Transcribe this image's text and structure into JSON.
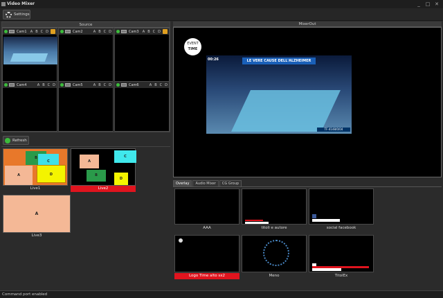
{
  "window": {
    "title": "Video Mixer",
    "minimize": "_",
    "maximize": "□",
    "close": "✕"
  },
  "toolbar": {
    "settings_label": "Settings"
  },
  "source": {
    "title": "Source",
    "cameras": [
      {
        "name": "Cam1",
        "letters": [
          "A",
          "B",
          "C",
          "D"
        ],
        "has_warning": true
      },
      {
        "name": "Cam2",
        "letters": [
          "A",
          "B",
          "C",
          "D"
        ],
        "has_warning": false
      },
      {
        "name": "Cam3",
        "letters": [
          "A",
          "B",
          "C",
          "D"
        ],
        "has_warning": true
      },
      {
        "name": "Cam4",
        "letters": [
          "A",
          "B",
          "C",
          "D"
        ],
        "has_warning": false
      },
      {
        "name": "Cam5",
        "letters": [
          "A",
          "B",
          "C",
          "D"
        ],
        "has_warning": false
      },
      {
        "name": "Cam6",
        "letters": [
          "A",
          "B",
          "C",
          "D"
        ],
        "has_warning": false
      }
    ]
  },
  "refresh": {
    "label": "Refresh"
  },
  "scenes": [
    {
      "label": "Live1",
      "boxes": [
        "A",
        "B",
        "C",
        "D"
      ]
    },
    {
      "label": "Live2",
      "boxes": [
        "A",
        "B",
        "C",
        "D"
      ],
      "active": true
    },
    {
      "label": "Live3",
      "boxes": [
        "A"
      ]
    }
  ],
  "mixer": {
    "title": "MixerOut",
    "logo_line1": "EVENT",
    "logo_line2": "TIME",
    "clock": "00:26",
    "headline": "LE VERE CAUSE DELL'ALZHEIMER",
    "ticker": "TF-4148/0/04"
  },
  "tabs": [
    "Overlay",
    "Audio Mixer",
    "CG Group"
  ],
  "overlays": [
    {
      "label": "AAA"
    },
    {
      "label": "titoli e autore"
    },
    {
      "label": "social facebook"
    },
    {
      "label": "Logo Time alto sx2",
      "active": true
    },
    {
      "label": "Meno"
    },
    {
      "label": "TitolEx"
    }
  ],
  "status": {
    "text": "Command port enabled"
  },
  "colors": {
    "active_red": "#e0141e",
    "green": "#3cbc3c",
    "scene_salmon": "#f4b896"
  }
}
